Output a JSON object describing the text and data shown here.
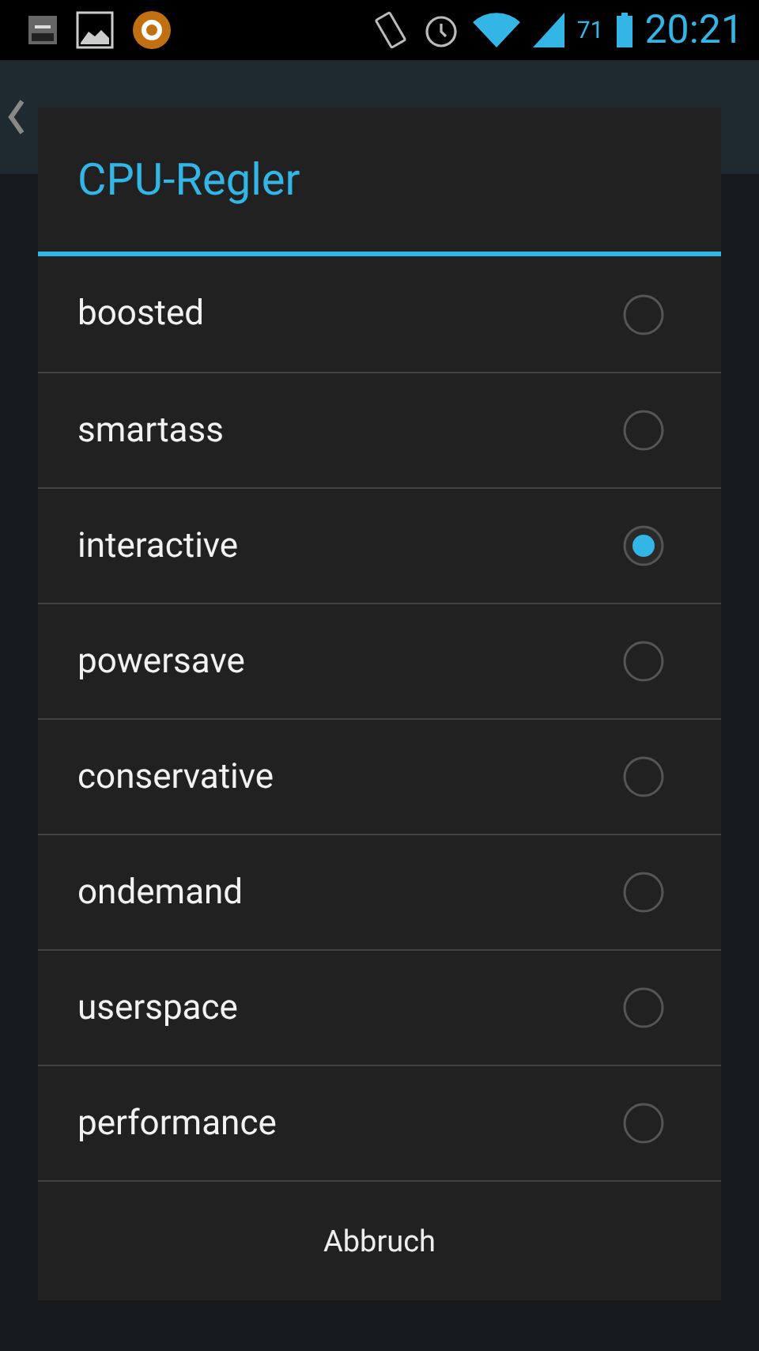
{
  "status_bar": {
    "battery_percent": "71",
    "time": "20:21"
  },
  "dialog": {
    "title": "CPU-Regler",
    "options": [
      {
        "label": "boosted",
        "selected": false
      },
      {
        "label": "smartass",
        "selected": false
      },
      {
        "label": "interactive",
        "selected": true
      },
      {
        "label": "powersave",
        "selected": false
      },
      {
        "label": "conservative",
        "selected": false
      },
      {
        "label": "ondemand",
        "selected": false
      },
      {
        "label": "userspace",
        "selected": false
      },
      {
        "label": "performance",
        "selected": false
      }
    ],
    "cancel": "Abbruch"
  }
}
